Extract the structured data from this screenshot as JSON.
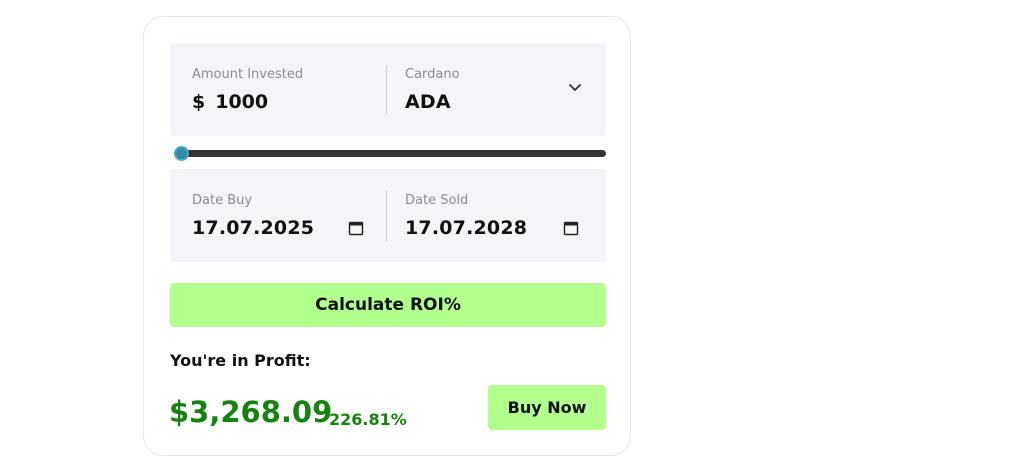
{
  "calculator": {
    "amount": {
      "label": "Amount Invested",
      "currency_symbol": "$",
      "value": "1000"
    },
    "coin": {
      "label": "Cardano",
      "value": "ADA"
    },
    "slider": {
      "level": 0.0
    },
    "date_buy": {
      "label": "Date Buy",
      "value": "17.07.2025"
    },
    "date_sold": {
      "label": "Date Sold",
      "value": "17.07.2028"
    },
    "calculate_label": "Calculate ROI%",
    "result": {
      "label": "You're in Profit:",
      "amount": "$3,268.09",
      "percent": "226.81%"
    },
    "buy_label": "Buy Now"
  },
  "colors": {
    "accent": "#b2ff8e",
    "profit": "#16830f",
    "slider_thumb": "#2f8cab",
    "panel_bg": "#f4f5f9"
  },
  "icons": [
    "chevron-down-icon",
    "calendar-icon"
  ]
}
